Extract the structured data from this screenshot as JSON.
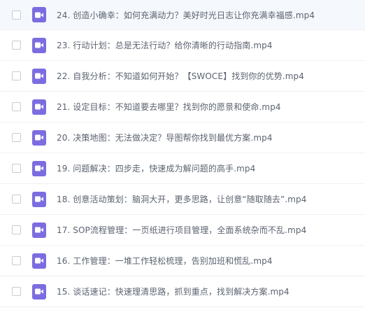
{
  "files": [
    {
      "name": "24. 创造小确幸：如何充满动力？美好时光日志让你充满幸福感.mp4",
      "icon": "video-file-icon"
    },
    {
      "name": "23. 行动计划：总是无法行动？给你清晰的行动指南.mp4",
      "icon": "video-file-icon"
    },
    {
      "name": "22. 自我分析：不知道如何开始？【SWOCE】找到你的优势.mp4",
      "icon": "video-file-icon"
    },
    {
      "name": "21. 设定目标：不知道要去哪里？找到你的愿景和使命.mp4",
      "icon": "video-file-icon"
    },
    {
      "name": "20. 决策地图：无法做决定？导图帮你找到最优方案.mp4",
      "icon": "video-file-icon"
    },
    {
      "name": "19. 问题解决：四步走，快速成为解问题的高手.mp4",
      "icon": "video-file-icon"
    },
    {
      "name": "18. 创意活动策划：脑洞大开，更多思路，让创意“随取随去”.mp4",
      "icon": "video-file-icon"
    },
    {
      "name": "17. SOP流程管理：一页纸进行项目管理，全面系统杂而不乱.mp4",
      "icon": "video-file-icon"
    },
    {
      "name": "16. 工作管理：一堆工作轻松梳理，告别加班和慌乱.mp4",
      "icon": "video-file-icon"
    },
    {
      "name": "15. 谈话速记：快速理清思路，抓到重点，找到解决方案.mp4",
      "icon": "video-file-icon"
    }
  ],
  "colors": {
    "icon_bg": "#7b6de0",
    "text": "#5b6370",
    "row_highlight": "#f5f8fc",
    "divider": "#eef0f3"
  }
}
